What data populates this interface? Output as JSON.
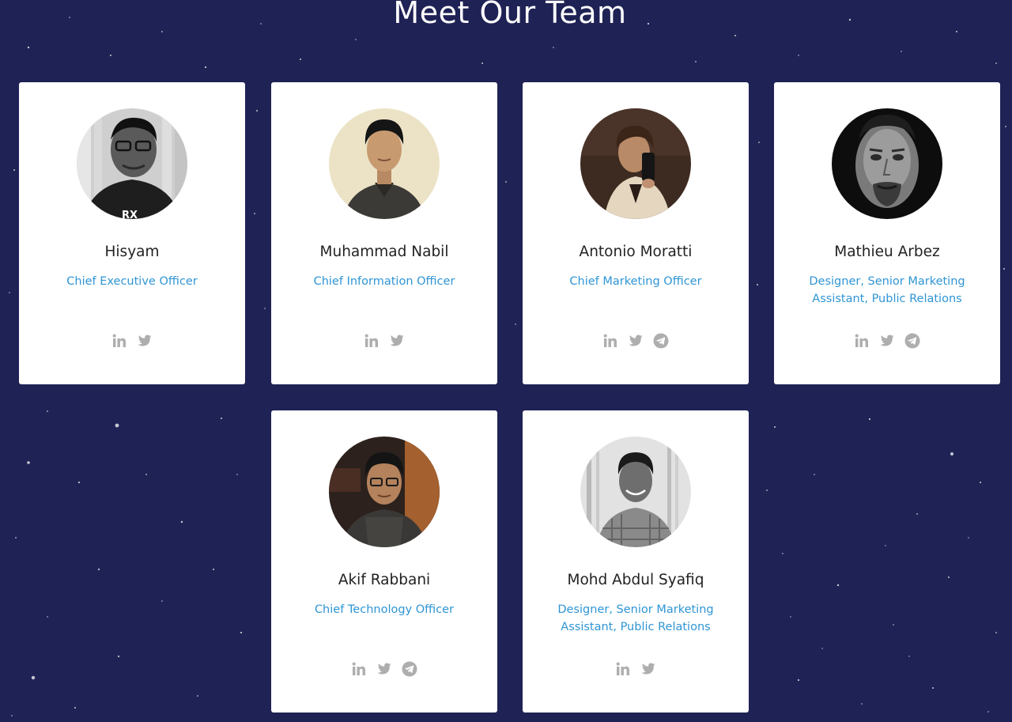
{
  "page": {
    "title": "Meet Our Team",
    "background_color": "#1f2254",
    "accent_color": "#2f95d4",
    "icon_color": "#aeaeae"
  },
  "team": [
    {
      "name": "Hisyam",
      "role": "Chief Executive Officer",
      "photo": "grayscale portrait, man with glasses, dark t-shirt",
      "social": [
        "linkedin-icon",
        "twitter-icon"
      ]
    },
    {
      "name": "Muhammad Nabil",
      "role": "Chief Information Officer",
      "photo": "portrait, young man in dark shirt, light background",
      "social": [
        "linkedin-icon",
        "twitter-icon"
      ]
    },
    {
      "name": "Antonio Moratti",
      "role": "Chief Marketing Officer",
      "photo": "portrait, man taking mirror selfie, warm tones",
      "social": [
        "linkedin-icon",
        "twitter-icon",
        "telegram-icon"
      ]
    },
    {
      "name": "Mathieu Arbez",
      "role": "Designer, Senior Marketing Assistant, Public Relations",
      "photo": "black and white close-up portrait, man with beard",
      "social": [
        "linkedin-icon",
        "twitter-icon",
        "telegram-icon"
      ]
    },
    {
      "name": "Akif Rabbani",
      "role": "Chief Technology Officer",
      "photo": "portrait, young man with glasses, indoor warm background",
      "social": [
        "linkedin-icon",
        "twitter-icon",
        "telegram-icon"
      ]
    },
    {
      "name": "Mohd Abdul Syafiq",
      "role": "Designer, Senior Marketing Assistant, Public Relations",
      "photo": "grayscale portrait, smiling man in checkered shirt",
      "social": [
        "linkedin-icon",
        "twitter-icon"
      ]
    }
  ]
}
